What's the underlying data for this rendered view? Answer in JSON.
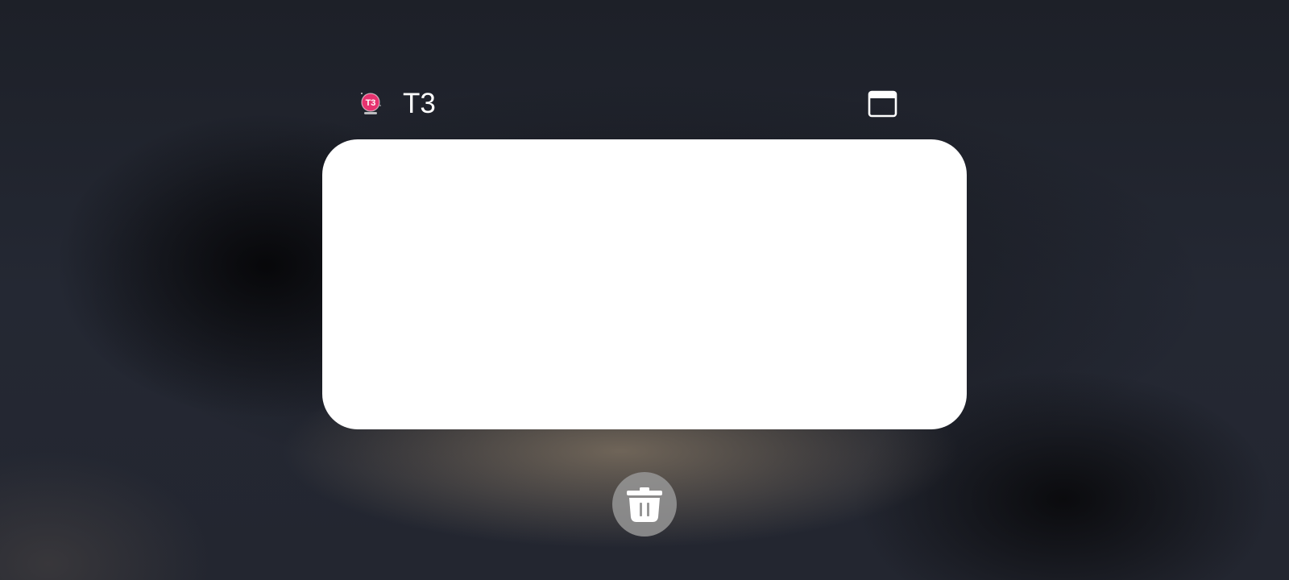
{
  "recents": {
    "task": {
      "app_name": "T3",
      "app_icon": "t3-app-icon",
      "app_icon_text": "T3"
    },
    "header": {
      "window_mode_icon": "window-icon"
    },
    "actions": {
      "clear_icon": "trash-icon"
    }
  },
  "colors": {
    "background": "#22262f",
    "card": "#ffffff",
    "title_text": "#ffffff",
    "app_icon_accent": "#e6336f",
    "clear_button": "#969696"
  }
}
